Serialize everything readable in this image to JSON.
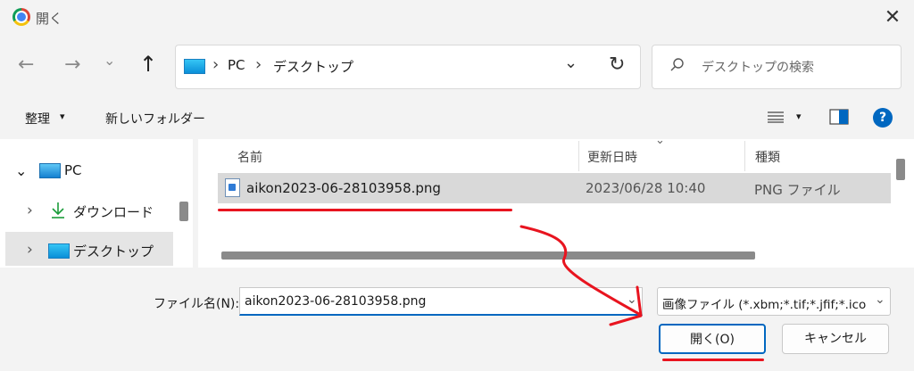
{
  "window": {
    "title": "開く",
    "close_label": "✕"
  },
  "nav": {
    "back": "←",
    "forward": "→",
    "recent": "⌄",
    "up": "↑",
    "breadcrumb": [
      "PC",
      "デスクトップ"
    ],
    "crumb_sep": "›",
    "dropdown": "⌄",
    "refresh": "↻",
    "search_placeholder": "デスクトップの検索"
  },
  "toolbar": {
    "organize": "整理",
    "organize_caret": "▾",
    "new_folder": "新しいフォルダー",
    "view_caret": "▾",
    "help": "?"
  },
  "sidebar": {
    "items": [
      {
        "chevron": "⌄",
        "label": "PC"
      },
      {
        "chevron": "›",
        "label": "ダウンロード"
      },
      {
        "chevron": "›",
        "label": "デスクトップ"
      }
    ]
  },
  "files": {
    "columns": [
      "名前",
      "更新日時",
      "種類"
    ],
    "sort_caret": "⌄",
    "rows": [
      {
        "name": "aikon2023-06-28103958.png",
        "modified": "2023/06/28 10:40",
        "type": "PNG ファイル"
      }
    ]
  },
  "bottom": {
    "filename_label": "ファイル名(N):",
    "filename_value": "aikon2023-06-28103958.png",
    "filename_caret": "⌄",
    "filetype_value": "画像ファイル (*.xbm;*.tif;*.jfif;*.ico",
    "filetype_caret": "⌄",
    "open_button": "開く(O)",
    "cancel_button": "キャンセル"
  },
  "colors": {
    "accent": "#0067c0",
    "annotation": "#e8141f"
  }
}
